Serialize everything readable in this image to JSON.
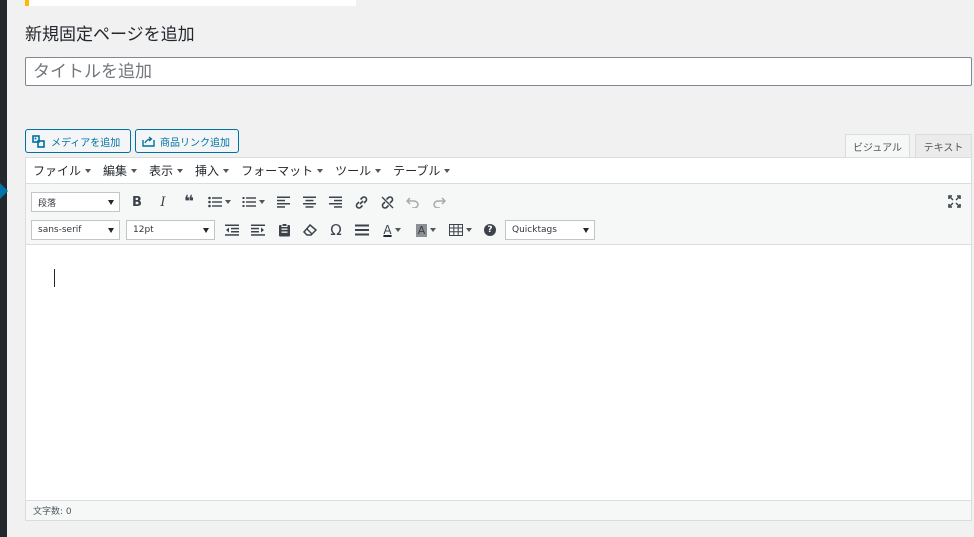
{
  "page": {
    "title": "新規固定ページを追加",
    "title_placeholder": "タイトルを追加"
  },
  "media_buttons": {
    "add_media": "メディアを追加",
    "product_link": "商品リンク追加"
  },
  "editor_tabs": {
    "visual": "ビジュアル",
    "text": "テキスト"
  },
  "menubar": [
    {
      "label": "ファイル"
    },
    {
      "label": "編集"
    },
    {
      "label": "表示"
    },
    {
      "label": "挿入"
    },
    {
      "label": "フォーマット"
    },
    {
      "label": "ツール"
    },
    {
      "label": "テーブル"
    }
  ],
  "toolbar": {
    "format_select": "段落",
    "font_family": "sans-serif",
    "font_size": "12pt",
    "quicktags": "Quicktags",
    "bold_glyph": "B",
    "italic_glyph": "I",
    "quote_glyph": "❝",
    "omega_glyph": "Ω",
    "text_color_glyph": "A",
    "bg_color_glyph": "A",
    "help_glyph": "?"
  },
  "status": {
    "word_count": "文字数: 0"
  },
  "colors": {
    "accent": "#0073aa",
    "button_blue": "#0071a1",
    "notice_yellow": "#ffb900",
    "admin_bar": "#23282d"
  }
}
